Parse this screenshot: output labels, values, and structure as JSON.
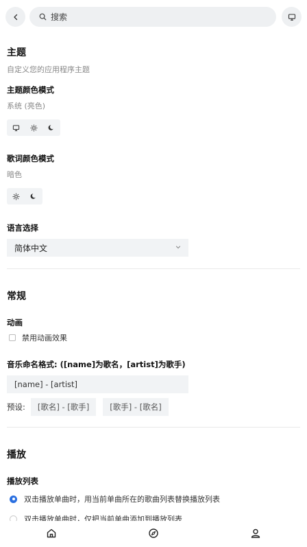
{
  "search": {
    "placeholder": "搜索"
  },
  "theme": {
    "title": "主题",
    "subtitle": "自定义您的应用程序主题",
    "color_mode_title": "主题颜色模式",
    "color_mode_value": "系统 (亮色)",
    "color_mode_options": [
      "monitor-icon",
      "sun-icon",
      "moon-icon"
    ],
    "lyric_mode_title": "歌词颜色模式",
    "lyric_mode_value": "暗色",
    "lyric_mode_options": [
      "sun-icon",
      "moon-icon"
    ],
    "language_title": "语言选择",
    "language_value": "简体中文"
  },
  "general": {
    "title": "常规",
    "animation_title": "动画",
    "disable_animation_label": "禁用动画效果",
    "naming_title": "音乐命名格式: ([name]为歌名，[artist]为歌手)",
    "naming_value": "[name] - [artist]",
    "preset_label": "预设:",
    "presets": [
      "[歌名] - [歌手]",
      "[歌手] - [歌名]"
    ]
  },
  "playback": {
    "title": "播放",
    "playlist_title": "播放列表",
    "options": [
      {
        "label": "双击播放单曲时，用当前单曲所在的歌曲列表替换播放列表",
        "selected": true
      },
      {
        "label": "双击播放单曲时，仅把当前单曲添加到播放列表",
        "selected": false
      }
    ]
  },
  "colors": {
    "accent": "#2a6fe0",
    "control_bg": "#f1f3f5"
  },
  "nav": [
    "home-icon",
    "compass-icon",
    "user-icon"
  ]
}
